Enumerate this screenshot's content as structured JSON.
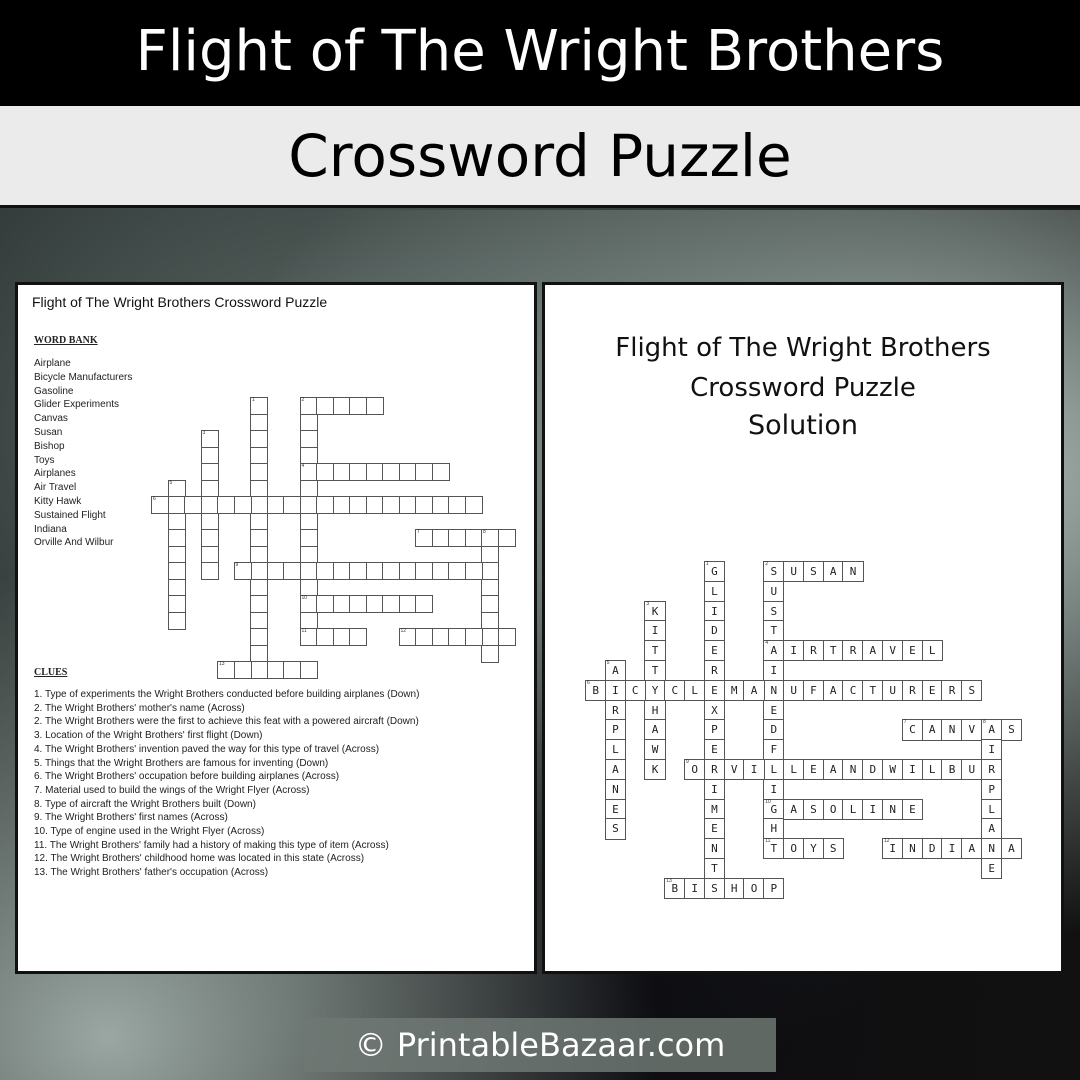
{
  "header": {
    "title": "Flight of The Wright Brothers",
    "subtitle": "Crossword Puzzle"
  },
  "puzzle_page": {
    "title": "Flight of The Wright Brothers Crossword Puzzle",
    "word_bank_heading": "WORD BANK",
    "word_bank": [
      "Airplane",
      "Bicycle Manufacturers",
      "Gasoline",
      "Glider Experiments",
      "Canvas",
      "Susan",
      "Bishop",
      "Toys",
      "Airplanes",
      "Air Travel",
      "Kitty Hawk",
      "Sustained Flight",
      "Indiana",
      "Orville And Wilbur"
    ],
    "clues_heading": "CLUES",
    "clues": [
      "1. Type of experiments the Wright Brothers conducted before building airplanes (Down)",
      "2. The Wright Brothers' mother's name (Across)",
      "2. The Wright Brothers were the first to achieve this feat with a powered aircraft (Down)",
      "3. Location of the Wright Brothers' first flight (Down)",
      "4. The Wright Brothers' invention paved the way for this type of travel (Across)",
      "5. Things that the Wright Brothers are famous for inventing (Down)",
      "6. The Wright Brothers' occupation before building airplanes (Across)",
      "7. Material used to build the wings of the Wright Flyer (Across)",
      "8. Type of aircraft the Wright Brothers built (Down)",
      "9. The Wright Brothers' first names (Across)",
      "10. Type of engine used in the Wright Flyer (Across)",
      "11. The Wright Brothers' family had a history of making this type of item (Across)",
      "12. The Wright Brothers' childhood home was located in this state (Across)",
      "13. The Wright Brothers' father's occupation (Across)"
    ]
  },
  "solution_page": {
    "title_line1": "Flight of The Wright Brothers",
    "title_line2": "Crossword Puzzle",
    "title_line3": "Solution"
  },
  "crossword": {
    "entries": [
      {
        "n": 1,
        "dir": "down",
        "row": 0,
        "col": 6,
        "answer": "GLIDEREXPERIMENTS"
      },
      {
        "n": 2,
        "dir": "across",
        "row": 0,
        "col": 9,
        "answer": "SUSAN"
      },
      {
        "n": 2,
        "dir": "down",
        "row": 0,
        "col": 9,
        "answer": "SUSTAINEDFLIGHT"
      },
      {
        "n": 3,
        "dir": "down",
        "row": 2,
        "col": 3,
        "answer": "KITTYHAWK"
      },
      {
        "n": 4,
        "dir": "across",
        "row": 4,
        "col": 9,
        "answer": "AIRTRAVEL"
      },
      {
        "n": 5,
        "dir": "down",
        "row": 5,
        "col": 1,
        "answer": "AIRPLANES"
      },
      {
        "n": 6,
        "dir": "across",
        "row": 6,
        "col": 0,
        "answer": "BICYCLEMANUFACTURERS"
      },
      {
        "n": 7,
        "dir": "across",
        "row": 8,
        "col": 16,
        "answer": "CANVAS"
      },
      {
        "n": 8,
        "dir": "down",
        "row": 8,
        "col": 20,
        "answer": "AIRPLANE"
      },
      {
        "n": 9,
        "dir": "across",
        "row": 10,
        "col": 5,
        "answer": "ORVILLEANDWILBUR"
      },
      {
        "n": 10,
        "dir": "across",
        "row": 12,
        "col": 9,
        "answer": "GASOLINE"
      },
      {
        "n": 11,
        "dir": "across",
        "row": 14,
        "col": 9,
        "answer": "TOYS"
      },
      {
        "n": 12,
        "dir": "across",
        "row": 14,
        "col": 15,
        "answer": "INDIANA"
      },
      {
        "n": 13,
        "dir": "across",
        "row": 16,
        "col": 4,
        "answer": "BISHOP"
      }
    ]
  },
  "footer": {
    "copyright": "© PrintableBazaar.com"
  }
}
